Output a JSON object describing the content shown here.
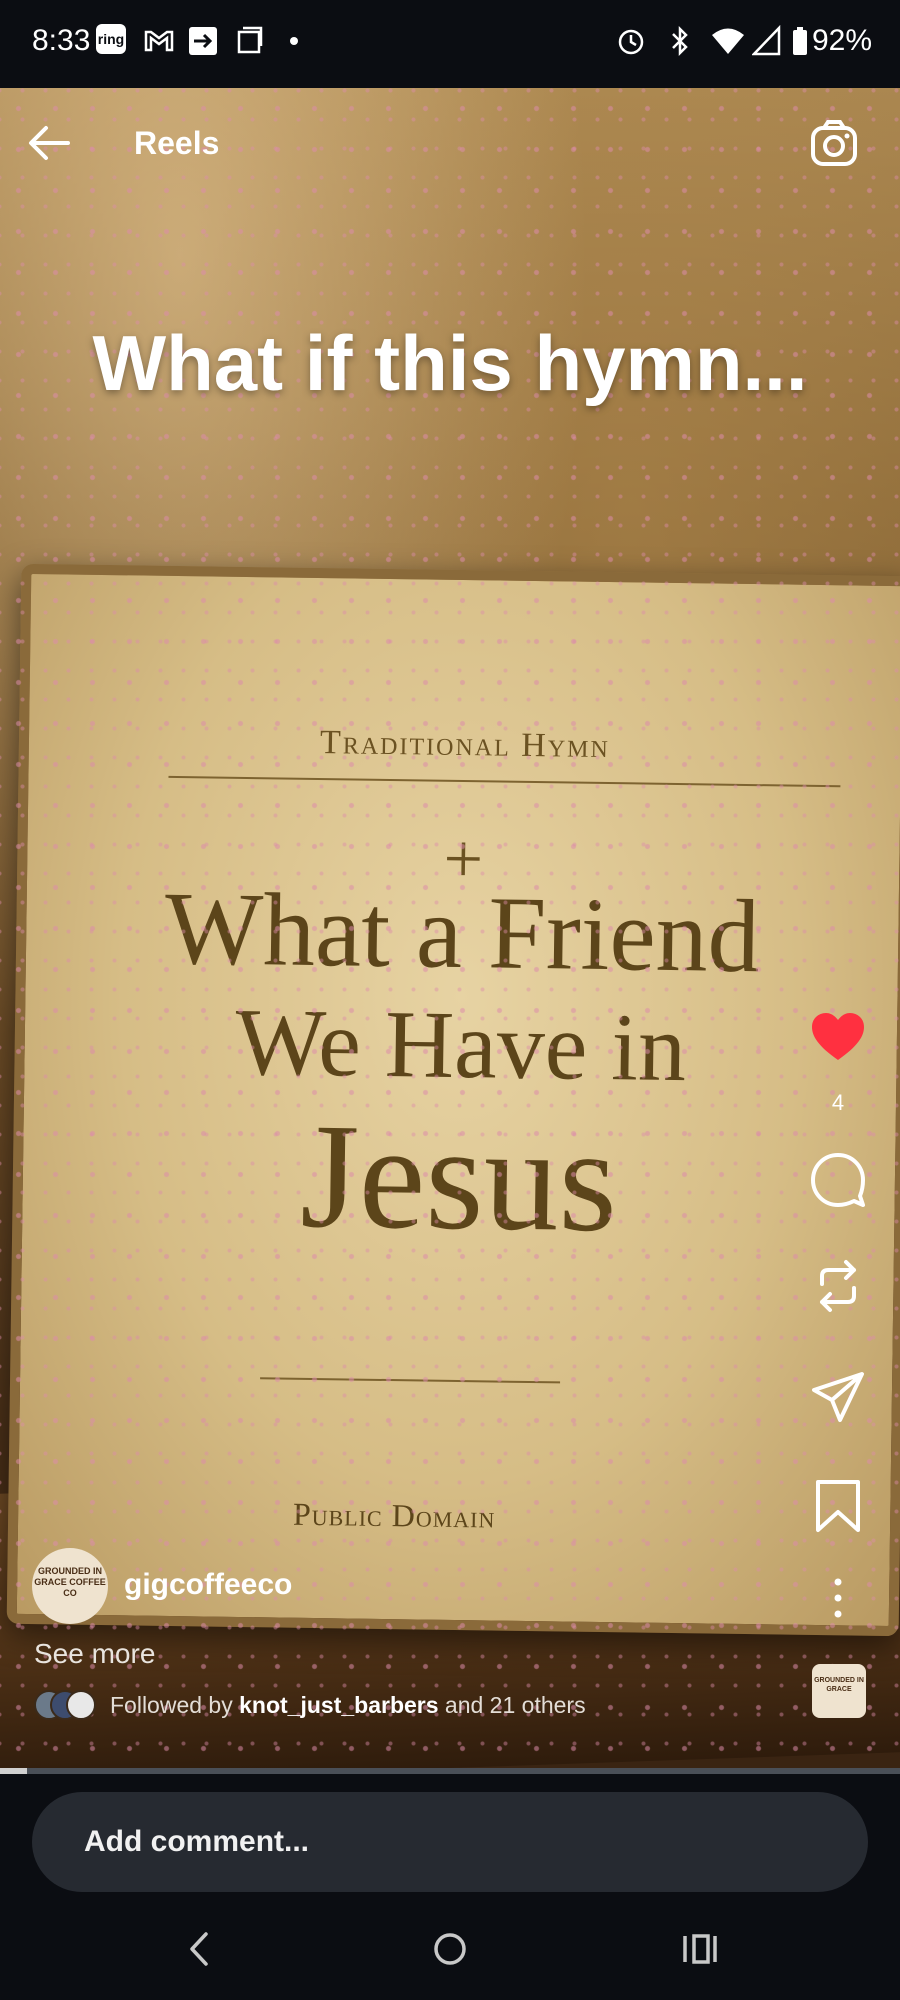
{
  "status_bar": {
    "time": "8:33",
    "ring_label": "ring",
    "battery": "92%"
  },
  "header": {
    "title": "Reels"
  },
  "reel": {
    "overlay_caption": "What if this hymn...",
    "book": {
      "kicker": "Traditional Hymn",
      "cross": "+",
      "title_line1": "What a Friend",
      "title_line2": "We Have in",
      "title_line3": "Jesus",
      "footer": "Public Domain"
    }
  },
  "actions": {
    "like_count": "4",
    "like_color": "#ff3040"
  },
  "author": {
    "username": "gigcoffeeco",
    "avatar_text": "GROUNDED IN GRACE COFFEE CO",
    "see_more": "See more",
    "followed_prefix": "Followed by",
    "followed_user": "knot_just_barbers",
    "followed_suffix": "and 21 others",
    "audio_thumb_text": "GROUNDED IN GRACE"
  },
  "playback": {
    "progress_fraction": 0.03
  },
  "comment": {
    "placeholder": "Add comment..."
  },
  "icons": [
    "back-arrow-icon",
    "camera-icon",
    "heart-icon",
    "comment-icon",
    "repost-icon",
    "send-icon",
    "bookmark-icon",
    "more-icon",
    "nav-back-icon",
    "nav-home-icon",
    "nav-recents-icon",
    "gmail-icon",
    "alarm-icon",
    "bluetooth-icon",
    "wifi-icon",
    "signal-icon",
    "battery-icon"
  ]
}
